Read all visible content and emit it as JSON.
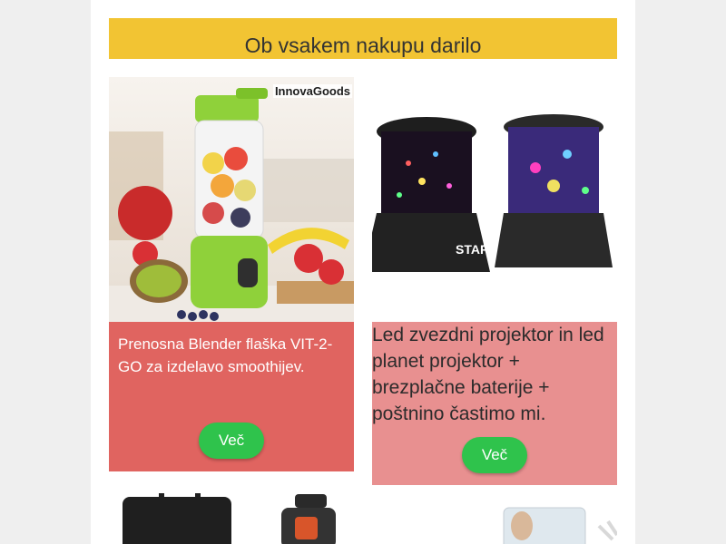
{
  "promo": {
    "banner_text": "Ob vsakem nakupu darilo"
  },
  "products": [
    {
      "image_icon": "blender-bottle-image",
      "brand_logo": "InnovaGoods",
      "title": "Prenosna Blender flaška VIT-2-GO za izdelavo smoothijev.",
      "button_label": "Več"
    },
    {
      "image_icon": "star-projector-image",
      "title": "Led zvezdni projektor in led planet projektor + brezplačne baterije + poštnino častimo mi.",
      "button_label": "Več"
    }
  ],
  "next_products": [
    {
      "image_icon": "heated-seat-cushion-image"
    },
    {
      "image_icon": "led-mirror-image"
    }
  ],
  "colors": {
    "banner": "#f2c433",
    "card_primary": "#e06460",
    "card_secondary": "#e89090",
    "button": "#2fc34c"
  }
}
